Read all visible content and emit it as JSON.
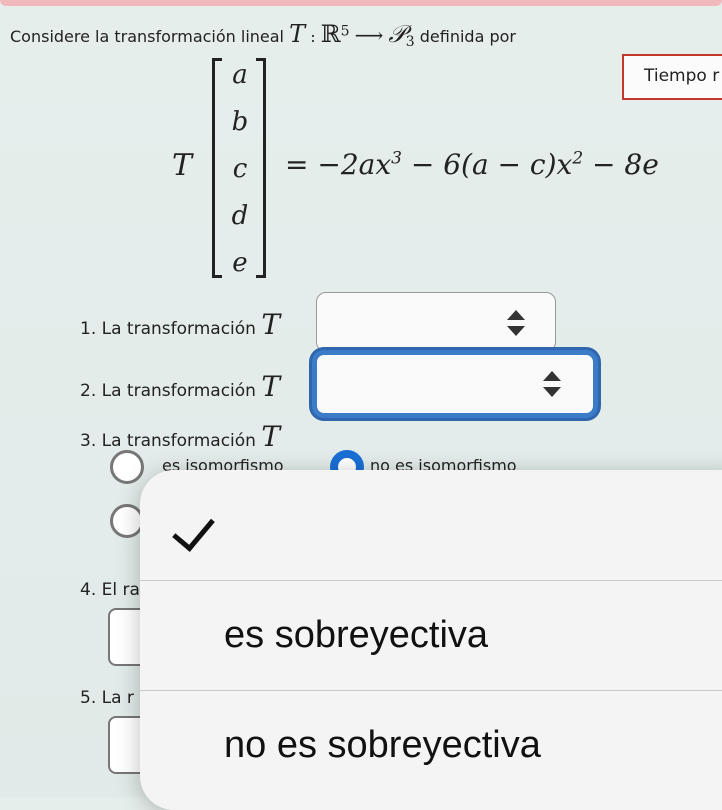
{
  "intro": {
    "prefix": "Considere la transformación lineal",
    "T": "T",
    "colon": ":",
    "domain": "ℝ",
    "domain_exp": "5",
    "arrow": "⟶",
    "codomain": "𝒫",
    "codomain_sub": "3",
    "suffix": "definida por"
  },
  "timer_label": "Tiempo r",
  "matrix": {
    "T": "T",
    "entries": [
      "a",
      "b",
      "c",
      "d",
      "e"
    ]
  },
  "formula": {
    "eq": "= −2ax",
    "exp1": "3",
    "mid": " − 6(a − c)x",
    "exp2": "2",
    "tail": " − 8e"
  },
  "questions": [
    {
      "num": "1.",
      "text": "La transformación",
      "T": "T"
    },
    {
      "num": "2.",
      "text": "La transformación",
      "T": "T"
    },
    {
      "num": "3.",
      "text": "La transformación",
      "T": "T"
    },
    {
      "num": "4.",
      "text": "El ra"
    },
    {
      "num": "5.",
      "text": "La r"
    }
  ],
  "q3_options": [
    "es isomorfismo",
    "no es isomorfismo"
  ],
  "dropdown_menu": {
    "items": [
      {
        "label": "",
        "checked": true
      },
      {
        "label": "es sobreyectiva",
        "checked": false
      },
      {
        "label": "no es sobreyectiva",
        "checked": false
      }
    ]
  },
  "colors": {
    "focus_ring": "#3b7bc8",
    "radio_selected": "#1a6fd6",
    "timer_border": "#c0392b"
  }
}
